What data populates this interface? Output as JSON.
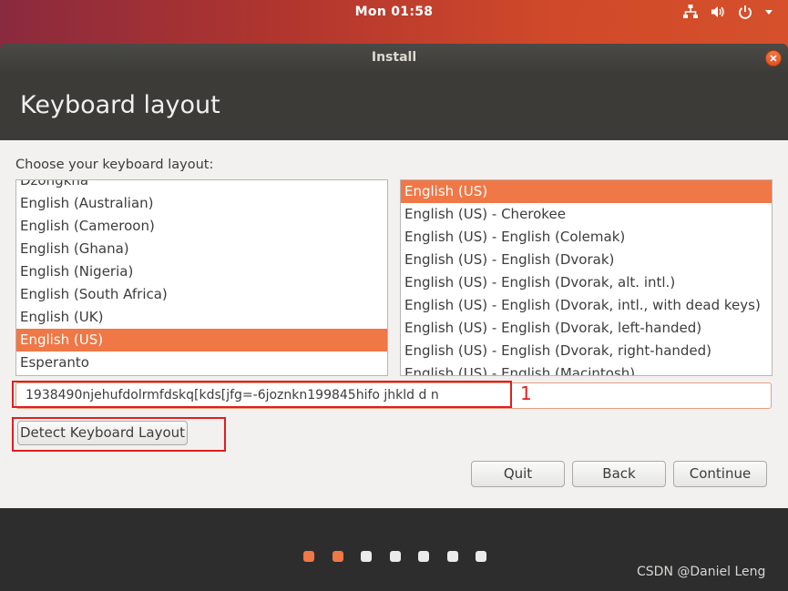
{
  "top_panel": {
    "clock": "Mon 01:58",
    "tray_icons": [
      "network-icon",
      "volume-icon",
      "power-icon",
      "chevron-down-icon"
    ]
  },
  "window": {
    "title": "Install",
    "page_title": "Keyboard layout",
    "choose_label": "Choose your keyboard layout:"
  },
  "layouts": [
    "Dzongkha",
    "English (Australian)",
    "English (Cameroon)",
    "English (Ghana)",
    "English (Nigeria)",
    "English (South Africa)",
    "English (UK)",
    "English (US)",
    "Esperanto"
  ],
  "selected_layout": "English (US)",
  "variants": [
    "English (US)",
    "English (US) - Cherokee",
    "English (US) - English (Colemak)",
    "English (US) - English (Dvorak)",
    "English (US) - English (Dvorak, alt. intl.)",
    "English (US) - English (Dvorak, intl., with dead keys)",
    "English (US) - English (Dvorak, left-handed)",
    "English (US) - English (Dvorak, right-handed)",
    "English (US) - English (Macintosh)"
  ],
  "selected_variant": "English (US)",
  "test_input": {
    "value": "1938490njehufdolrmfdskq[kds[jfg=-6joznkn199845hifo  jhkld d n"
  },
  "annotation_label": "1",
  "buttons": {
    "detect": "Detect Keyboard Layout",
    "quit": "Quit",
    "back": "Back",
    "continue": "Continue"
  },
  "progress": {
    "total_steps": 7,
    "completed_steps": 2
  },
  "watermark": "CSDN @Daniel Leng",
  "colors": {
    "accent": "#f07746",
    "header_bg": "#3c3b37",
    "annotation": "#e21d1d"
  }
}
